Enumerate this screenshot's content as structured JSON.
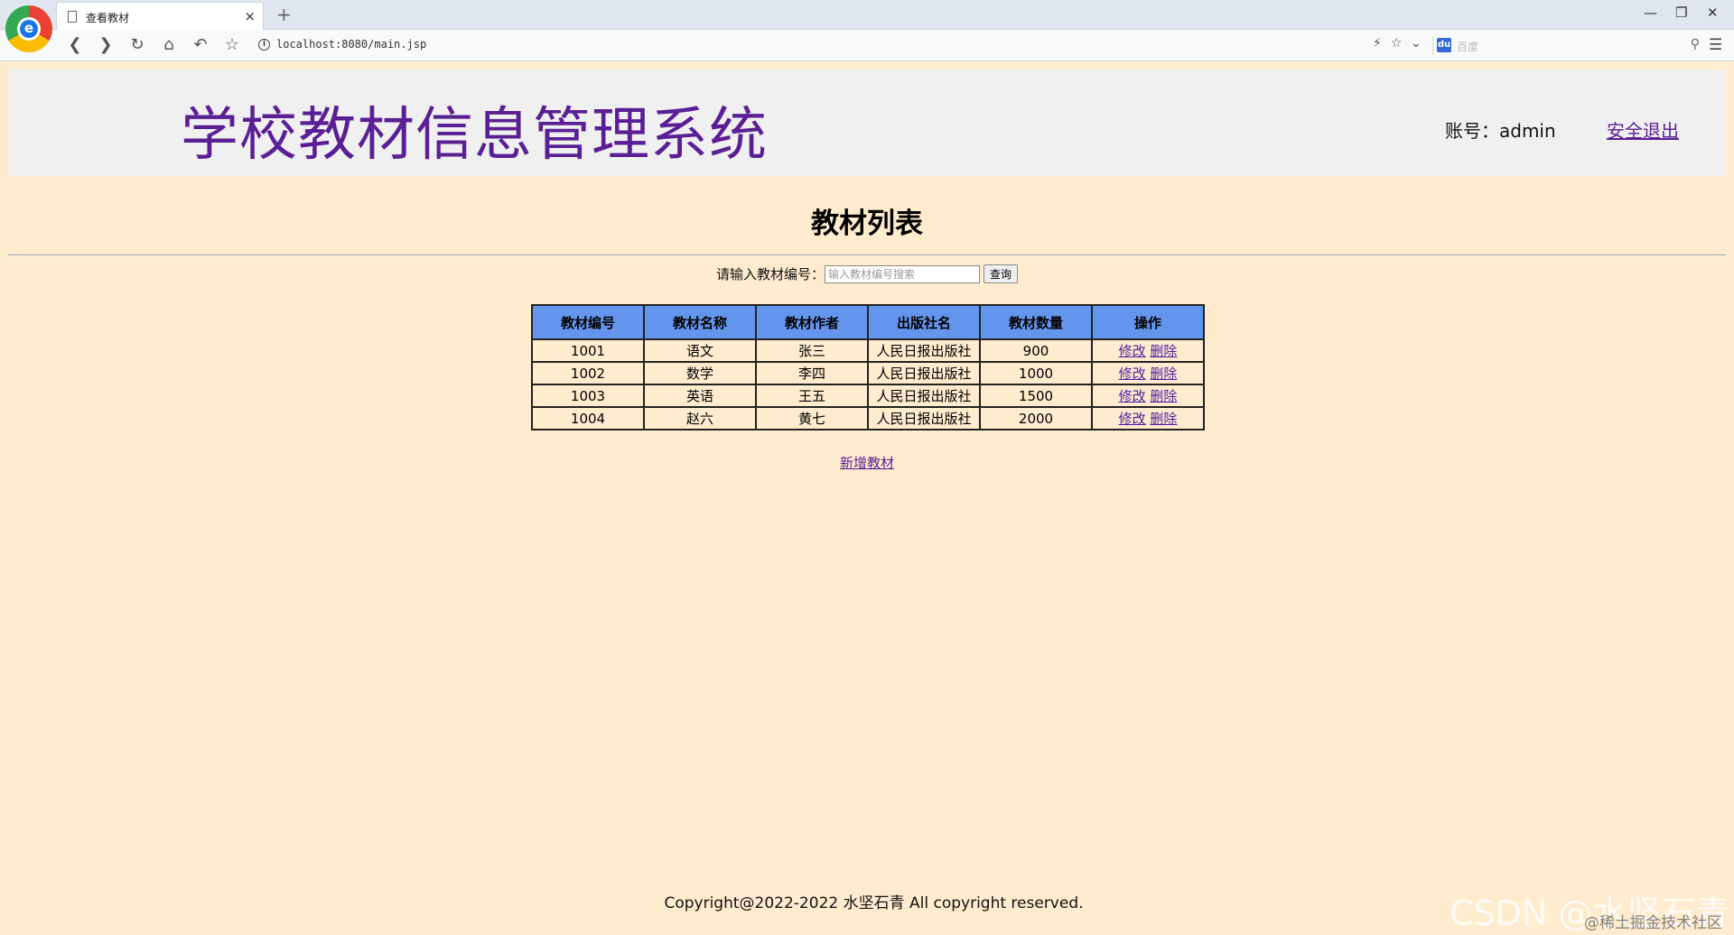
{
  "browser": {
    "tab_title": "查看教材",
    "tab_close": "×",
    "new_tab": "+",
    "url": "localhost:8080/main.jsp",
    "search_placeholder": "百度",
    "window_controls": {
      "minimize": "—",
      "restore": "❐",
      "close": "✕"
    },
    "icons": [
      "back-icon",
      "forward-icon",
      "reload-icon",
      "home-icon",
      "undo-icon",
      "star-icon",
      "info-icon",
      "lightning-icon",
      "star-outline-icon",
      "chevron-down-icon",
      "search-icon",
      "menu-icon"
    ]
  },
  "header": {
    "title": "学校教材信息管理系统",
    "account": "账号：admin",
    "logout": "安全退出"
  },
  "main": {
    "list_title": "教材列表",
    "search_label": "请输入教材编号：",
    "search_placeholder": "输入教材编号搜索",
    "search_button": "查询",
    "table": {
      "headers": [
        "教材编号",
        "教材名称",
        "教材作者",
        "出版社名",
        "教材数量",
        "操作"
      ],
      "rows": [
        {
          "id": "1001",
          "name": "语文",
          "author": "张三",
          "publisher": "人民日报出版社",
          "qty": "900",
          "edit": "修改",
          "delete": "删除"
        },
        {
          "id": "1002",
          "name": "数学",
          "author": "李四",
          "publisher": "人民日报出版社",
          "qty": "1000",
          "edit": "修改",
          "delete": "删除"
        },
        {
          "id": "1003",
          "name": "英语",
          "author": "王五",
          "publisher": "人民日报出版社",
          "qty": "1500",
          "edit": "修改",
          "delete": "删除"
        },
        {
          "id": "1004",
          "name": "赵六",
          "author": "黄七",
          "publisher": "人民日报出版社",
          "qty": "2000",
          "edit": "修改",
          "delete": "删除"
        }
      ]
    },
    "add_link": "新增教材"
  },
  "footer": {
    "copyright": "Copyright@2022-2022 水坚石青 All copyright reserved."
  },
  "watermark": {
    "csdn": "CSDN @水坚石青",
    "juejin": "@稀土掘金技术社区"
  },
  "colors": {
    "page_bg": "#ffebcd",
    "header_bg": "#f0f0f0",
    "title_color": "#5b1f95",
    "table_header_bg": "#6495ed"
  }
}
